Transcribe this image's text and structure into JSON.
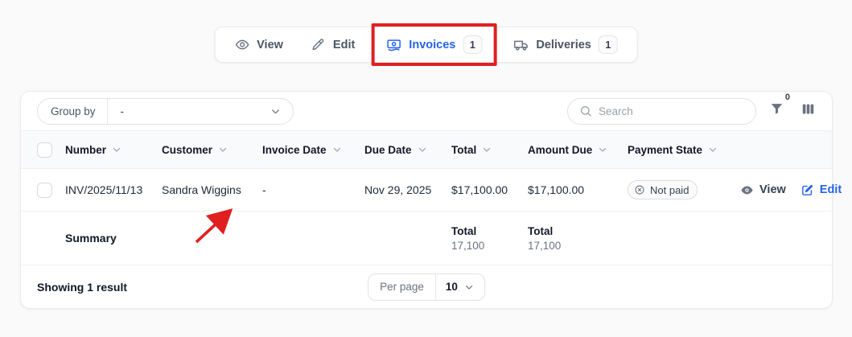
{
  "toolbar": {
    "tabs": [
      {
        "label": "View"
      },
      {
        "label": "Edit"
      },
      {
        "label": "Invoices",
        "count": "1",
        "active": true,
        "highlighted": true
      },
      {
        "label": "Deliveries",
        "count": "1"
      }
    ]
  },
  "table": {
    "group_by": {
      "label": "Group by",
      "value": "-"
    },
    "search": {
      "placeholder": "Search"
    },
    "filter": {
      "count": "0"
    },
    "columns": [
      "Number",
      "Customer",
      "Invoice Date",
      "Due Date",
      "Total",
      "Amount Due",
      "Payment State"
    ],
    "rows": [
      {
        "number": "INV/2025/11/13",
        "customer": "Sandra Wiggins",
        "invoice_date": "-",
        "due_date": "Nov 29, 2025",
        "total": "$17,100.00",
        "amount_due": "$17,100.00",
        "payment_state": "Not paid",
        "view_label": "View",
        "edit_label": "Edit"
      }
    ],
    "summary": {
      "label": "Summary",
      "total_label": "Total",
      "total_value": "17,100",
      "amount_due_label": "Total",
      "amount_due_value": "17,100"
    },
    "footer": {
      "showing": "Showing 1 result",
      "per_page_label": "Per page",
      "per_page_value": "10"
    }
  },
  "colors": {
    "accent_blue": "#2563eb",
    "highlight_red": "#e02020",
    "header_bg": "#f9fafb"
  }
}
